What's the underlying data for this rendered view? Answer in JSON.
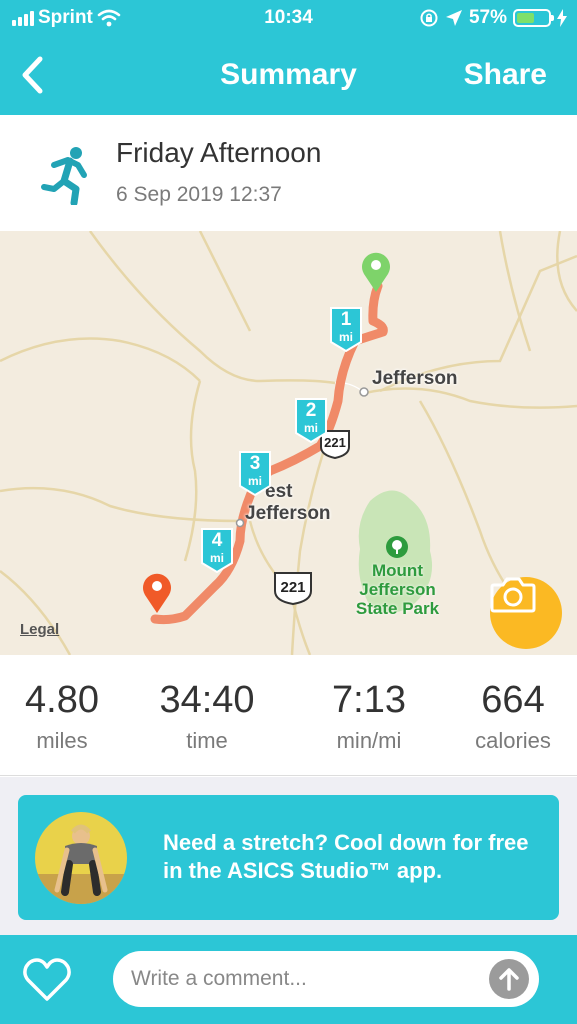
{
  "status_bar": {
    "carrier": "Sprint",
    "time": "10:34",
    "battery_percent": "57%",
    "battery_level": 0.57,
    "icons": [
      "cellular-signal-icon",
      "wifi-icon",
      "rotation-lock-icon",
      "location-arrow-icon",
      "battery-icon",
      "charging-bolt-icon"
    ]
  },
  "nav": {
    "title": "Summary",
    "share_label": "Share",
    "back_icon": "chevron-left-icon"
  },
  "activity": {
    "icon": "runner-icon",
    "title": "Friday Afternoon",
    "date": "6 Sep 2019 12:37"
  },
  "map": {
    "places": {
      "jefferson": "Jefferson",
      "west_jefferson_line1": "est",
      "west_jefferson_line2": "Jefferson",
      "park_line1": "Mount",
      "park_line2": "Jefferson",
      "park_line3": "State Park"
    },
    "highway_shields": [
      "221",
      "221"
    ],
    "mile_markers": [
      {
        "num": "1",
        "unit": "mi"
      },
      {
        "num": "2",
        "unit": "mi"
      },
      {
        "num": "3",
        "unit": "mi"
      },
      {
        "num": "4",
        "unit": "mi"
      }
    ],
    "legal": "Legal",
    "colors": {
      "route": "#f08a68",
      "start_pin": "#7ed36a",
      "end_pin": "#f05a28",
      "marker": "#2cc6d6",
      "park": "#c9e5b7"
    }
  },
  "stats": [
    {
      "value": "4.80",
      "unit": "miles"
    },
    {
      "value": "34:40",
      "unit": "time"
    },
    {
      "value": "7:13",
      "unit": "min/mi"
    },
    {
      "value": "664",
      "unit": "calories"
    }
  ],
  "promo": {
    "text": "Need a stretch? Cool down for free in the ASICS Studio™ app."
  },
  "comment": {
    "placeholder": "Write a comment..."
  },
  "colors": {
    "accent": "#2cc6d6",
    "camera": "#fbb923"
  }
}
